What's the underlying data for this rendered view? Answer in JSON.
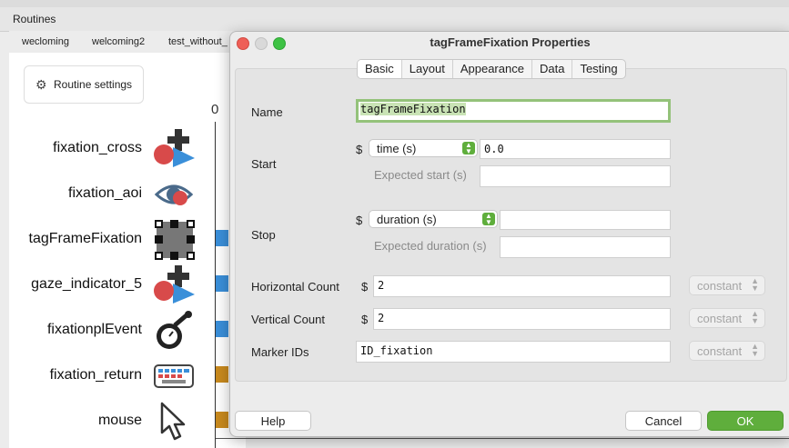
{
  "routines_title": "Routines",
  "routine_tabs": [
    "wecloming",
    "welcoming2",
    "test_without_"
  ],
  "routine_settings_label": "Routine settings",
  "timeline_zero": "0",
  "components": [
    {
      "name": "fixation_cross",
      "icon": "shape-polygon-icon"
    },
    {
      "name": "fixation_aoi",
      "icon": "eye-aoi-icon"
    },
    {
      "name": "tagFrameFixation",
      "icon": "marker-grid-icon"
    },
    {
      "name": "gaze_indicator_5",
      "icon": "shape-polygon-icon"
    },
    {
      "name": "fixationplEvent",
      "icon": "stamp-icon"
    },
    {
      "name": "fixation_return",
      "icon": "keyboard-icon"
    },
    {
      "name": "mouse",
      "icon": "mouse-cursor-icon"
    }
  ],
  "bar_colors": {
    "blue": "#3a8fd9",
    "orange": "#c98a1e"
  },
  "dialog": {
    "title": "tagFrameFixation Properties",
    "tabs": [
      "Basic",
      "Layout",
      "Appearance",
      "Data",
      "Testing"
    ],
    "selected_tab": "Basic",
    "name_label": "Name",
    "name_value": "tagFrameFixation",
    "start_label": "Start",
    "start_dollar": "$",
    "start_type": "time (s)",
    "start_value": "0.0",
    "expected_start_label": "Expected start (s)",
    "stop_label": "Stop",
    "stop_dollar": "$",
    "stop_type": "duration (s)",
    "stop_value": "",
    "expected_duration_label": "Expected duration (s)",
    "horizontal_label": "Horizontal Count",
    "horizontal_dollar": "$",
    "horizontal_value": "2",
    "horizontal_update": "constant",
    "vertical_label": "Vertical Count",
    "vertical_dollar": "$",
    "vertical_value": "2",
    "vertical_update": "constant",
    "marker_label": "Marker IDs",
    "marker_value": "ID_fixation",
    "marker_update": "constant",
    "help_label": "Help",
    "cancel_label": "Cancel",
    "ok_label": "OK"
  }
}
